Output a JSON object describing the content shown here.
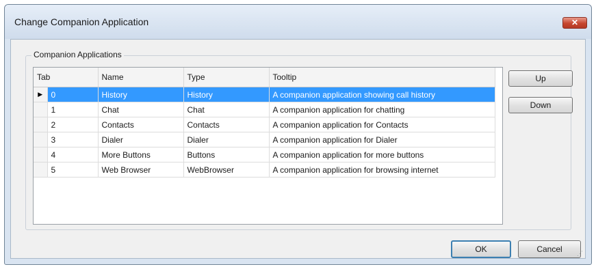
{
  "window": {
    "title": "Change Companion Application",
    "close_label": "✕"
  },
  "group": {
    "label": "Companion Applications"
  },
  "table": {
    "columns": [
      "Tab",
      "Name",
      "Type",
      "Tooltip"
    ],
    "selected_row": 0,
    "rows": [
      {
        "tab": "0",
        "name": "History",
        "type": "History",
        "tooltip": "A companion application showing call history"
      },
      {
        "tab": "1",
        "name": "Chat",
        "type": "Chat",
        "tooltip": "A companion application for chatting"
      },
      {
        "tab": "2",
        "name": "Contacts",
        "type": "Contacts",
        "tooltip": "A companion application for Contacts"
      },
      {
        "tab": "3",
        "name": "Dialer",
        "type": "Dialer",
        "tooltip": "A companion application for Dialer"
      },
      {
        "tab": "4",
        "name": "More Buttons",
        "type": "Buttons",
        "tooltip": "A companion application for more buttons"
      },
      {
        "tab": "5",
        "name": "Web Browser",
        "type": "WebBrowser",
        "tooltip": "A companion application for browsing internet"
      }
    ]
  },
  "buttons": {
    "up": "Up",
    "down": "Down",
    "ok": "OK",
    "cancel": "Cancel"
  },
  "icons": {
    "row_indicator": "▶",
    "resize_grip": "⋰"
  }
}
